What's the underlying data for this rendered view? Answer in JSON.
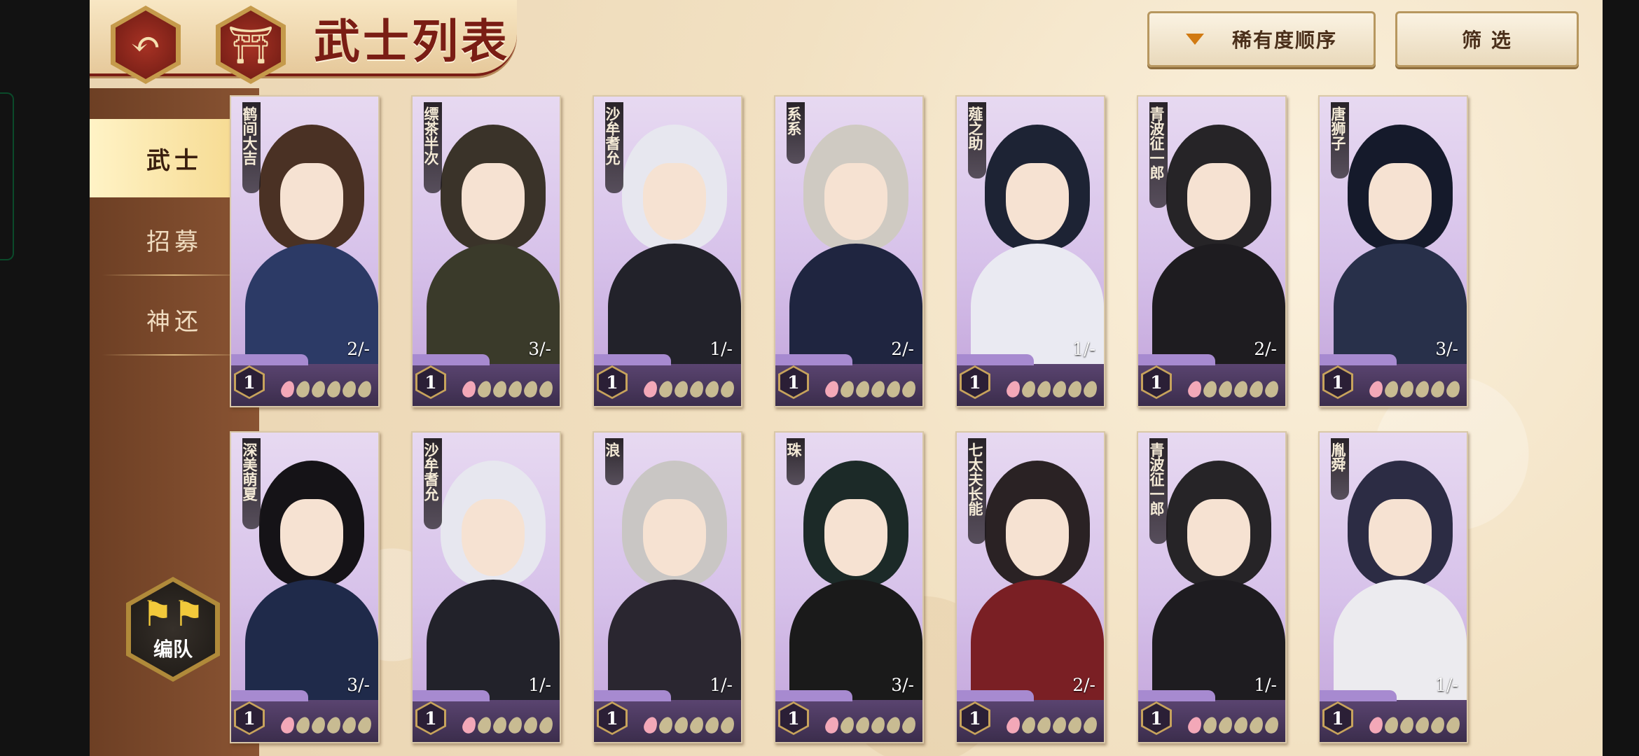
{
  "header": {
    "title": "武士列表",
    "back_icon": "back-arrow-icon",
    "home_icon": "shrine-gate-icon"
  },
  "toolbar": {
    "sort_label": "稀有度顺序",
    "filter_label": "筛 选"
  },
  "sidebar": {
    "items": [
      {
        "label": "武士",
        "active": true
      },
      {
        "label": "招募",
        "active": false
      },
      {
        "label": "神还",
        "active": false
      }
    ],
    "team_label": "编队"
  },
  "cards": [
    {
      "name": "鹤间大吉",
      "count": "2/-",
      "level": "1",
      "hair": "#4a3124",
      "body": "#2c3a66"
    },
    {
      "name": "缥茶半次",
      "count": "3/-",
      "level": "1",
      "hair": "#3a3329",
      "body": "#3a3a2a"
    },
    {
      "name": "沙牟耆允",
      "count": "1/-",
      "level": "1",
      "hair": "#e7e7ef",
      "body": "#22222a"
    },
    {
      "name": "系系",
      "count": "2/-",
      "level": "1",
      "hair": "#cfcac2",
      "body": "#1f2540"
    },
    {
      "name": "薤之助",
      "count": "1/-",
      "level": "1",
      "hair": "#1d2334",
      "body": "#eaeaf2"
    },
    {
      "name": "青波征一郎",
      "count": "2/-",
      "level": "1",
      "hair": "#262427",
      "body": "#1e1c20"
    },
    {
      "name": "唐狮子",
      "count": "3/-",
      "level": "1",
      "hair": "#151a2b",
      "body": "#28304a"
    },
    {
      "name": "深美萌夏",
      "count": "3/-",
      "level": "1",
      "hair": "#151317",
      "body": "#1f2a4a"
    },
    {
      "name": "沙牟耆允",
      "count": "1/-",
      "level": "1",
      "hair": "#e7e7ef",
      "body": "#22222a"
    },
    {
      "name": "浪",
      "count": "1/-",
      "level": "1",
      "hair": "#c9c6c4",
      "body": "#2a2630"
    },
    {
      "name": "珠",
      "count": "3/-",
      "level": "1",
      "hair": "#1c2a28",
      "body": "#1a1a1a"
    },
    {
      "name": "七太夫长能",
      "count": "2/-",
      "level": "1",
      "hair": "#2a2224",
      "body": "#7a1f24"
    },
    {
      "name": "青波征一郎",
      "count": "1/-",
      "level": "1",
      "hair": "#262427",
      "body": "#1e1c20"
    },
    {
      "name": "胤舜",
      "count": "1/-",
      "level": "1",
      "hair": "#2c2c44",
      "body": "#ecebef"
    }
  ],
  "colors": {
    "accent": "#7a1d14",
    "sidebar_active": "#f5d78a",
    "card_frame": "#3b2d4c"
  }
}
